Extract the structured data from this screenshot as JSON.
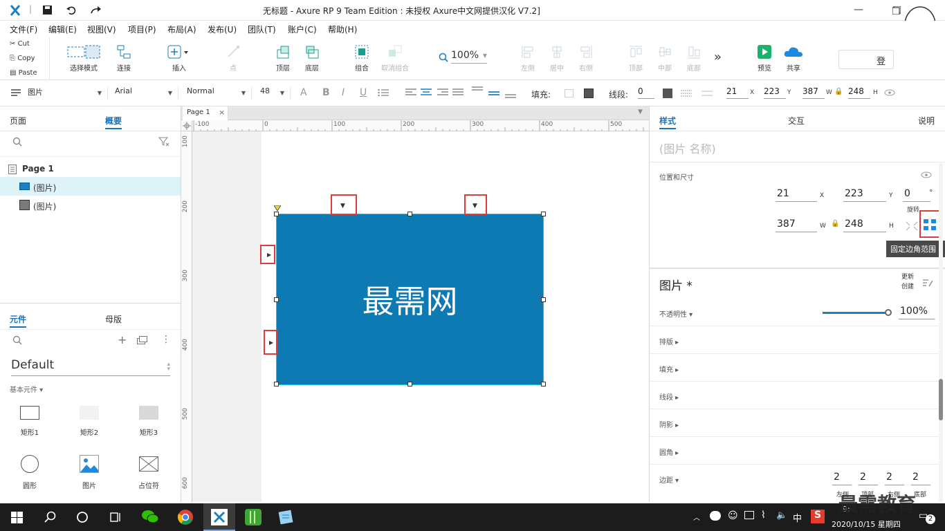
{
  "window": {
    "title": "无标题 - Axure RP 9 Team Edition : 未授权     Axure中文网提供汉化 V7.2]",
    "controls": [
      "minimize-icon",
      "maximize-icon",
      "close-icon"
    ]
  },
  "menu": [
    "文件(F)",
    "编辑(E)",
    "视图(V)",
    "项目(P)",
    "布局(A)",
    "发布(U)",
    "团队(T)",
    "账户(C)",
    "帮助(H)"
  ],
  "clipboard": [
    "Cut",
    "Copy",
    "Paste"
  ],
  "toolbar": {
    "select_mode": "选择模式",
    "connect": "连接",
    "insert": "插入",
    "point": "点",
    "top": "顶层",
    "bottom": "底层",
    "group": "组合",
    "ungroup": "取消组合",
    "zoom": "100%",
    "align_left": "左侧",
    "align_center": "居中",
    "align_right": "右侧",
    "align_top": "顶部",
    "align_middle": "中部",
    "align_bottom": "底部",
    "more": "»",
    "preview": "预览",
    "share": "共享",
    "login": "登"
  },
  "format": {
    "style": "图片",
    "font": "Arial",
    "weight": "Normal",
    "size": "48",
    "fill_label": "填充:",
    "line_label": "线段:",
    "line_value": "0",
    "x": "21",
    "y": "223",
    "w": "387",
    "h": "248",
    "x_unit": "X",
    "y_unit": "Y",
    "w_unit": "W",
    "h_unit": "H"
  },
  "left": {
    "tab_pages": "页面",
    "tab_outline": "概要",
    "page": "Page 1",
    "items": [
      "(图片)",
      "(图片)"
    ],
    "lib_tab1": "元件",
    "lib_tab2": "母版",
    "library": "Default",
    "category": "基本元件 ▾",
    "widgets": [
      "矩形1",
      "矩形2",
      "矩形3",
      "圆形",
      "图片",
      "占位符"
    ]
  },
  "canvas": {
    "tab": "Page 1",
    "ruler_h": [
      "-100",
      "0",
      "100",
      "200",
      "300",
      "400",
      "500"
    ],
    "ruler_v": [
      "100",
      "200",
      "300",
      "400",
      "500",
      "600"
    ],
    "shape_text": "最需网",
    "shape_color": "#0d7ab3"
  },
  "right": {
    "tab_style": "样式",
    "tab_interact": "交互",
    "tab_notes": "说明",
    "name_placeholder": "(图片 名称)",
    "pos_size": "位置和尺寸",
    "x": "21",
    "y": "223",
    "rotate": "0",
    "rotate_unit": "°",
    "rotate_label": "旋转",
    "w": "387",
    "h": "248",
    "x_unit": "X",
    "y_unit": "Y",
    "w_unit": "W",
    "h_unit": "H",
    "tooltip": "固定边角范围",
    "section_title": "图片 *",
    "update": "更新",
    "create": "创建",
    "opacity_label": "不透明性 ▾",
    "opacity": "100%",
    "opacity_fraction": 1.0,
    "rows": [
      "排版 ▸",
      "填充 ▸",
      "线段 ▸",
      "阴影 ▸",
      "圆角 ▸"
    ],
    "padding_label": "边距 ▾",
    "padding": [
      "2",
      "2",
      "2",
      "2"
    ],
    "padding_labels": [
      "左侧",
      "顶部",
      "右侧",
      "底部"
    ]
  },
  "taskbar": {
    "ime": "中",
    "time": "9:",
    "date": "2020/10/15 星期四",
    "notify": "2",
    "watermark": "最需教育"
  }
}
